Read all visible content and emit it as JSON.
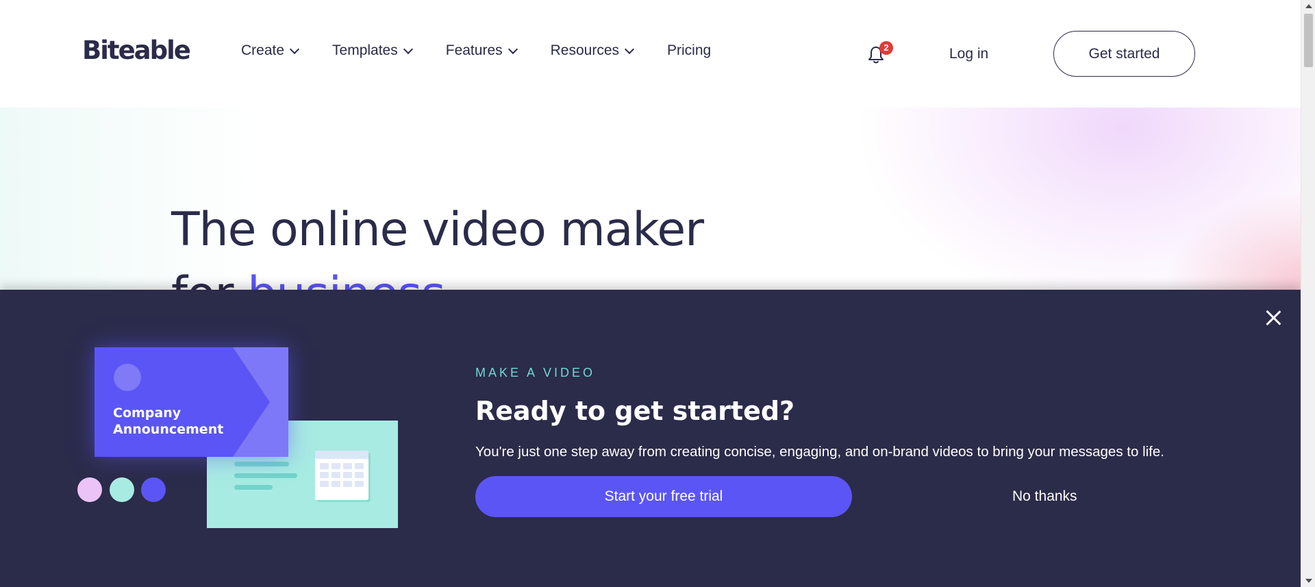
{
  "header": {
    "logo": "Biteable",
    "nav": [
      {
        "label": "Create",
        "has_dropdown": true
      },
      {
        "label": "Templates",
        "has_dropdown": true
      },
      {
        "label": "Features",
        "has_dropdown": true
      },
      {
        "label": "Resources",
        "has_dropdown": true
      },
      {
        "label": "Pricing",
        "has_dropdown": false
      }
    ],
    "notification_count": "2",
    "login_label": "Log in",
    "cta_label": "Get started"
  },
  "hero": {
    "title_line1": "The online video maker",
    "title_line2_prefix": "for ",
    "title_line2_accent": "business"
  },
  "modal": {
    "card_title": "Company Announcement",
    "eyebrow": "MAKE A VIDEO",
    "title": "Ready to get started?",
    "description": "You're just one step away from creating concise, engaging, and on-brand videos to bring your messages to life.",
    "primary_label": "Start your free trial",
    "secondary_label": "No thanks"
  },
  "colors": {
    "navy": "#2b2b4a",
    "brand_purple": "#5b55f5",
    "teal": "#6fdad0",
    "badge_red": "#e53935"
  },
  "icons": [
    "bell-icon",
    "chevron-down-icon",
    "close-icon",
    "calendar-icon"
  ]
}
